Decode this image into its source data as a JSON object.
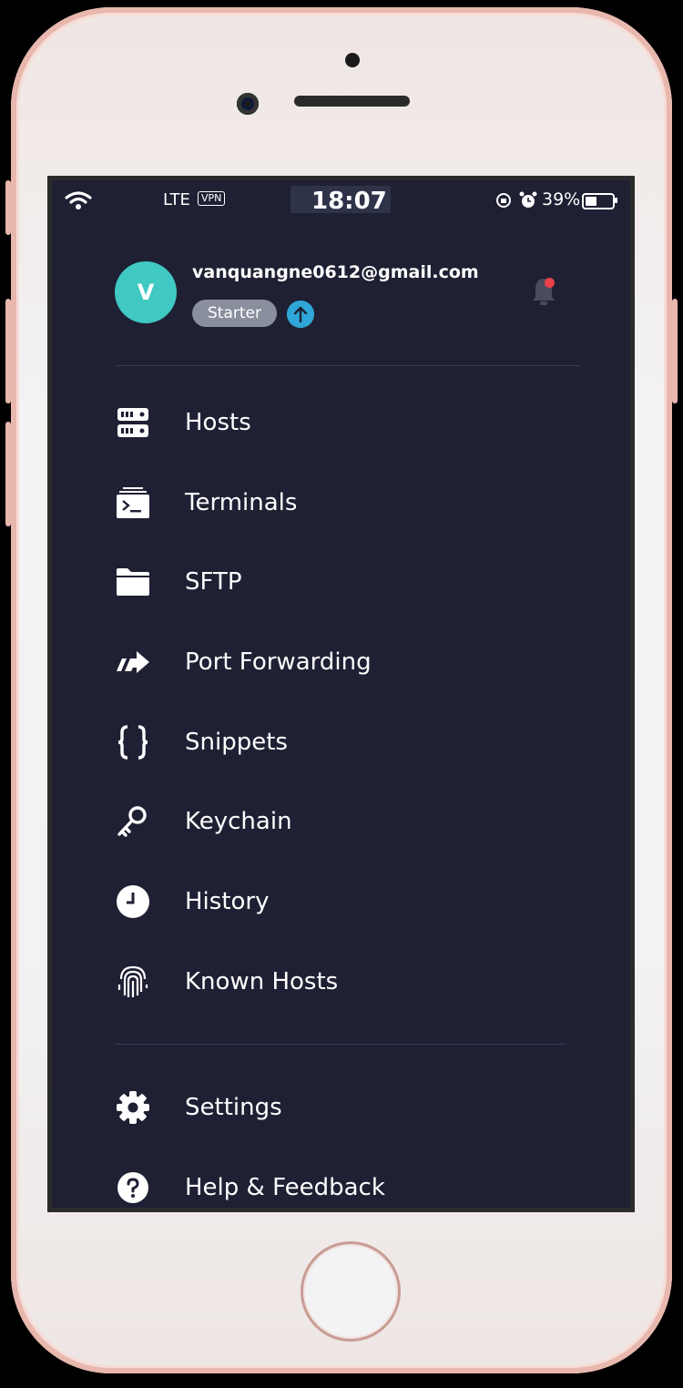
{
  "status_bar": {
    "carrier": "LTE",
    "vpn": "VPN",
    "time": "18:07",
    "battery": "39%"
  },
  "account": {
    "avatar_letter": "V",
    "email": "vanquangne0612@gmail.com",
    "plan": "Starter"
  },
  "menu": {
    "items": [
      {
        "label": "Hosts",
        "icon": "hosts-icon"
      },
      {
        "label": "Terminals",
        "icon": "terminal-icon"
      },
      {
        "label": "SFTP",
        "icon": "folder-icon"
      },
      {
        "label": "Port Forwarding",
        "icon": "port-forwarding-icon"
      },
      {
        "label": "Snippets",
        "icon": "braces-icon"
      },
      {
        "label": "Keychain",
        "icon": "key-icon"
      },
      {
        "label": "History",
        "icon": "clock-icon"
      },
      {
        "label": "Known Hosts",
        "icon": "fingerprint-icon"
      }
    ],
    "footer_items": [
      {
        "label": "Settings",
        "icon": "gear-icon"
      },
      {
        "label": "Help & Feedback",
        "icon": "help-icon"
      }
    ]
  },
  "colors": {
    "background": "#1f2033",
    "avatar": "#40c8c2",
    "notification_dot": "#e8414b",
    "plan_badge": "#8a8f9e"
  }
}
